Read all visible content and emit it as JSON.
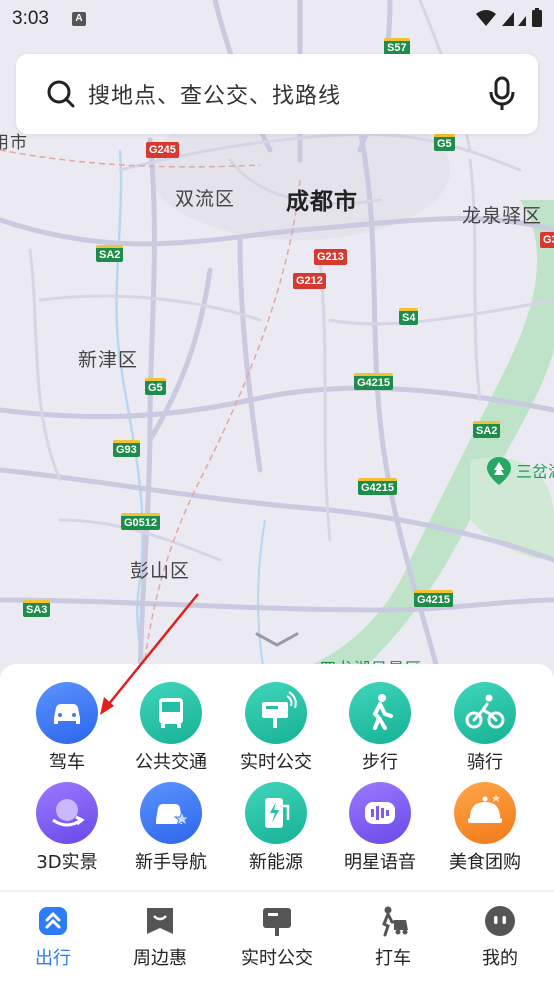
{
  "status_bar": {
    "time": "3:03",
    "notif_letter": "A"
  },
  "search": {
    "placeholder": "搜地点、查公交、找路线"
  },
  "map": {
    "places": [
      {
        "label": "成都市"
      },
      {
        "label": "双流区"
      },
      {
        "label": "龙泉驿区"
      },
      {
        "label": "新津区"
      },
      {
        "label": "彭山区"
      },
      {
        "label": "用市"
      },
      {
        "label": "四龙湖风景区"
      }
    ],
    "shields": [
      "S57",
      "G245",
      "G5",
      "G3",
      "SA2",
      "G213",
      "G212",
      "S4",
      "G5",
      "G4215",
      "SA2",
      "G93",
      "G4215",
      "G0512",
      "SA3",
      "G4215"
    ],
    "poi": {
      "label": "三岔湖"
    }
  },
  "quick_actions": [
    {
      "label": "驾车",
      "icon": "car-icon",
      "color": "#3d7cf5"
    },
    {
      "label": "公共交通",
      "icon": "bus-icon",
      "color": "#22bfa5"
    },
    {
      "label": "实时公交",
      "icon": "bus-stop-icon",
      "color": "#22bfa5"
    },
    {
      "label": "步行",
      "icon": "walk-icon",
      "color": "#22bfa5"
    },
    {
      "label": "骑行",
      "icon": "bike-icon",
      "color": "#22bfa5"
    },
    {
      "label": "3D实景",
      "icon": "globe-3d-icon",
      "color": "#7b5cf0"
    },
    {
      "label": "新手导航",
      "icon": "car-star-icon",
      "color": "#3d7cf5"
    },
    {
      "label": "新能源",
      "icon": "charging-icon",
      "color": "#22bfa5"
    },
    {
      "label": "明星语音",
      "icon": "voice-icon",
      "color": "#7b5cf0"
    },
    {
      "label": "美食团购",
      "icon": "food-icon",
      "color": "#f88a2c"
    }
  ],
  "tabbar": [
    {
      "label": "出行",
      "icon": "travel-icon",
      "active": true
    },
    {
      "label": "周边惠",
      "icon": "nearby-deal-icon",
      "active": false
    },
    {
      "label": "实时公交",
      "icon": "realtime-bus-icon",
      "active": false
    },
    {
      "label": "打车",
      "icon": "taxi-icon",
      "active": false
    },
    {
      "label": "我的",
      "icon": "profile-icon",
      "active": false
    }
  ]
}
